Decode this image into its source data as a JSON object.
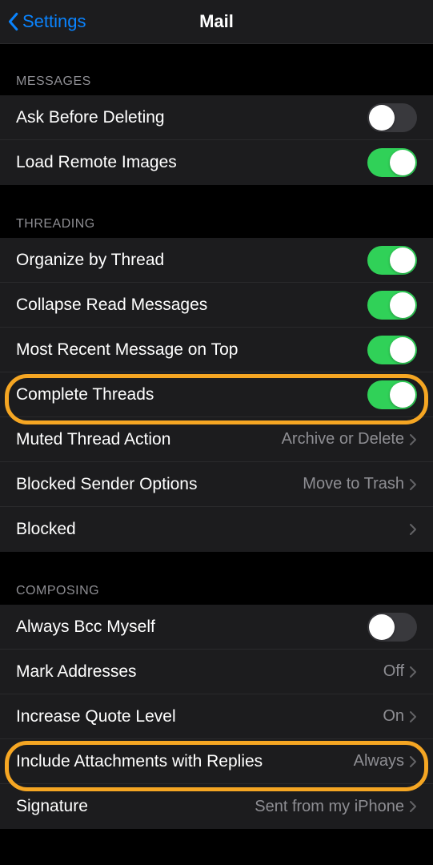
{
  "nav": {
    "back": "Settings",
    "title": "Mail"
  },
  "sections": {
    "messages": {
      "header": "MESSAGES",
      "rows": {
        "askBeforeDeleting": {
          "label": "Ask Before Deleting",
          "on": false
        },
        "loadRemoteImages": {
          "label": "Load Remote Images",
          "on": true
        }
      }
    },
    "threading": {
      "header": "THREADING",
      "rows": {
        "organizeByThread": {
          "label": "Organize by Thread",
          "on": true
        },
        "collapseReadMessages": {
          "label": "Collapse Read Messages",
          "on": true
        },
        "mostRecentOnTop": {
          "label": "Most Recent Message on Top",
          "on": true
        },
        "completeThreads": {
          "label": "Complete Threads",
          "on": true
        },
        "mutedThreadAction": {
          "label": "Muted Thread Action",
          "value": "Archive or Delete"
        },
        "blockedSenderOptions": {
          "label": "Blocked Sender Options",
          "value": "Move to Trash"
        },
        "blocked": {
          "label": "Blocked",
          "value": ""
        }
      }
    },
    "composing": {
      "header": "COMPOSING",
      "rows": {
        "alwaysBccMyself": {
          "label": "Always Bcc Myself",
          "on": false
        },
        "markAddresses": {
          "label": "Mark Addresses",
          "value": "Off"
        },
        "increaseQuoteLevel": {
          "label": "Increase Quote Level",
          "value": "On"
        },
        "includeAttachments": {
          "label": "Include Attachments with Replies",
          "value": "Always"
        },
        "signature": {
          "label": "Signature",
          "value": "Sent from my iPhone"
        }
      }
    }
  },
  "highlight_color": "#f5a623"
}
